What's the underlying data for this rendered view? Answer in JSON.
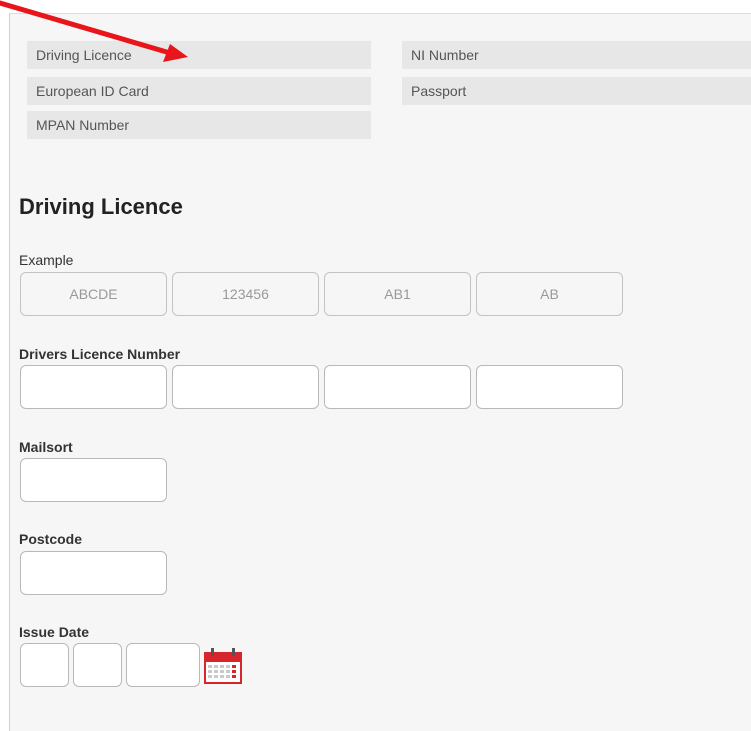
{
  "document_types": {
    "driving_licence": "Driving Licence",
    "european_id_card": "European ID Card",
    "mpan_number": "MPAN Number",
    "ni_number": "NI Number",
    "passport": "Passport"
  },
  "form": {
    "title": "Driving Licence",
    "example_label": "Example",
    "example_values": [
      "ABCDE",
      "123456",
      "AB1",
      "AB"
    ],
    "licence_number_label": "Drivers Licence Number",
    "licence_number_values": [
      "",
      "",
      "",
      ""
    ],
    "mailsort_label": "Mailsort",
    "mailsort_value": "",
    "postcode_label": "Postcode",
    "postcode_value": "",
    "issue_date_label": "Issue Date",
    "issue_date_values": [
      "",
      "",
      ""
    ]
  },
  "annotation": {
    "arrow_color": "#e8161b"
  },
  "icons": {
    "calendar": "calendar-icon"
  },
  "colors": {
    "calendar_red": "#d7262b"
  }
}
